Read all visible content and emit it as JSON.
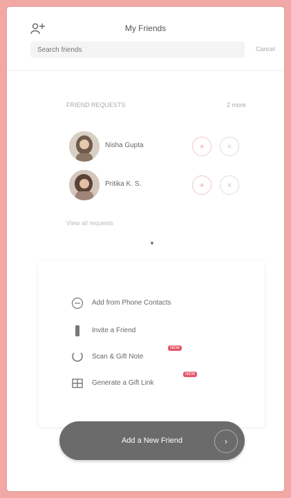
{
  "header": {
    "title": "My Friends",
    "search_placeholder": "Search friends",
    "search_extra": "Cancel"
  },
  "requests": {
    "heading": "FRIEND REQUESTS",
    "right_link": "2 more",
    "items": [
      {
        "name": "Nisha Gupta"
      },
      {
        "name": "Pritika K. S."
      }
    ],
    "accept_symbol": "+",
    "decline_symbol": "×"
  },
  "view_more": "View all requests",
  "chevron": "▼",
  "options": [
    {
      "label": "Add from Phone Contacts",
      "badge": ""
    },
    {
      "label": "Invite a Friend",
      "badge": ""
    },
    {
      "label": "Scan & Gift Note",
      "badge": "NEW"
    },
    {
      "label": "Generate a Gift Link",
      "badge": "NEW"
    }
  ],
  "cta": {
    "label": "Add a New Friend",
    "arrow": "›"
  }
}
